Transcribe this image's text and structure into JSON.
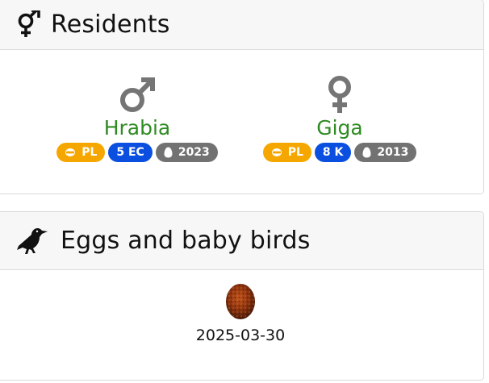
{
  "residents_card": {
    "title": "Residents",
    "header_icon": "mars-and-venus-icon",
    "birds": [
      {
        "name": "Hrabia",
        "sex_icon": "mars-icon",
        "name_color": "#2e8b22",
        "badges": [
          {
            "icon": "ring-icon",
            "label": "PL",
            "color": "#f5a700"
          },
          {
            "icon": "",
            "label": "5 EC",
            "color": "#0b4fe0"
          },
          {
            "icon": "egg-icon",
            "label": "2023",
            "color": "#727272"
          }
        ]
      },
      {
        "name": "Giga",
        "sex_icon": "venus-icon",
        "name_color": "#2e8b22",
        "badges": [
          {
            "icon": "ring-icon",
            "label": "PL",
            "color": "#f5a700"
          },
          {
            "icon": "",
            "label": "8 K",
            "color": "#0b4fe0"
          },
          {
            "icon": "egg-icon",
            "label": "2013",
            "color": "#727272"
          }
        ]
      }
    ]
  },
  "eggs_card": {
    "title": "Eggs and baby birds",
    "header_icon": "crow-icon",
    "items": [
      {
        "icon": "egg-photo-icon",
        "date": "2025-03-30"
      }
    ]
  }
}
